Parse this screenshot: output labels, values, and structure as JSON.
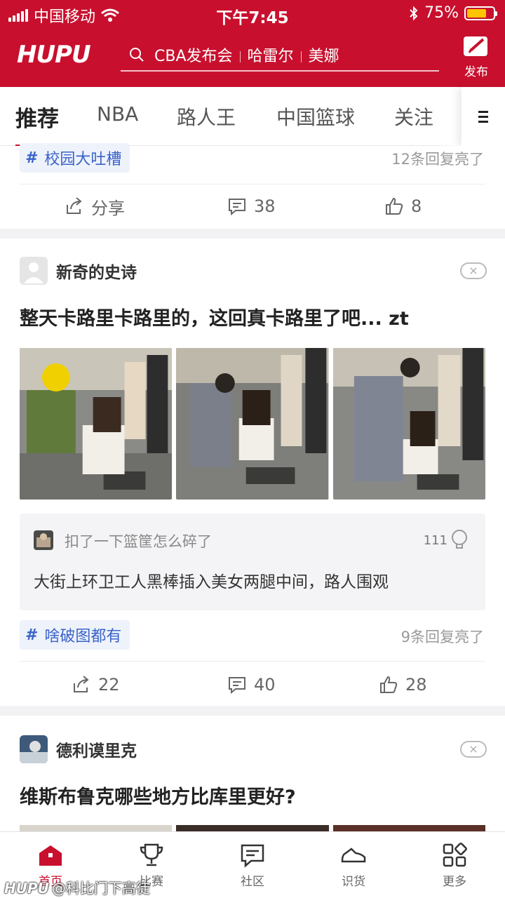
{
  "status_bar": {
    "carrier": "中国移动",
    "time": "下午7:45",
    "battery": "75%"
  },
  "header": {
    "logo": "HUPU",
    "search": {
      "hint_1": "CBA发布会",
      "hint_2": "哈雷尔",
      "hint_3": "美娜"
    },
    "publish_label": "发布"
  },
  "tabs": [
    {
      "label": "推荐",
      "active": true
    },
    {
      "label": "NBA"
    },
    {
      "label": "路人王"
    },
    {
      "label": "中国篮球"
    },
    {
      "label": "关注"
    }
  ],
  "posts": [
    {
      "topic": "校园大吐槽",
      "reply_note": "12条回复亮了",
      "actions": {
        "share": "分享",
        "comments": "38",
        "likes": "8"
      }
    },
    {
      "author": "新奇的史诗",
      "dismiss": "×",
      "title": "整天卡路里卡路里的，这回真卡路里了吧... zt",
      "quote": {
        "author": "扣了一下篮筐怎么碎了",
        "likes": "111",
        "text": "大街上环卫工人黑棒插入美女两腿中间，路人围观"
      },
      "topic": "啥破图都有",
      "reply_note": "9条回复亮了",
      "actions": {
        "shares": "22",
        "comments": "40",
        "likes": "28"
      }
    },
    {
      "author": "德利谟里克",
      "dismiss": "×",
      "title": "维斯布鲁克哪些地方比库里更好?"
    }
  ],
  "bottom_nav": [
    {
      "label": "首页",
      "icon": "home-icon",
      "active": true
    },
    {
      "label": "比赛",
      "icon": "trophy-icon"
    },
    {
      "label": "社区",
      "icon": "chat-icon"
    },
    {
      "label": "识货",
      "icon": "sneaker-icon"
    },
    {
      "label": "更多",
      "icon": "grid-icon"
    }
  ],
  "watermark": {
    "logo": "HUPU",
    "text": "@科比门下高徒"
  },
  "colors": {
    "brand": "#c8102e",
    "topic_blue": "#3b64c8",
    "battery": "#ffc400"
  }
}
